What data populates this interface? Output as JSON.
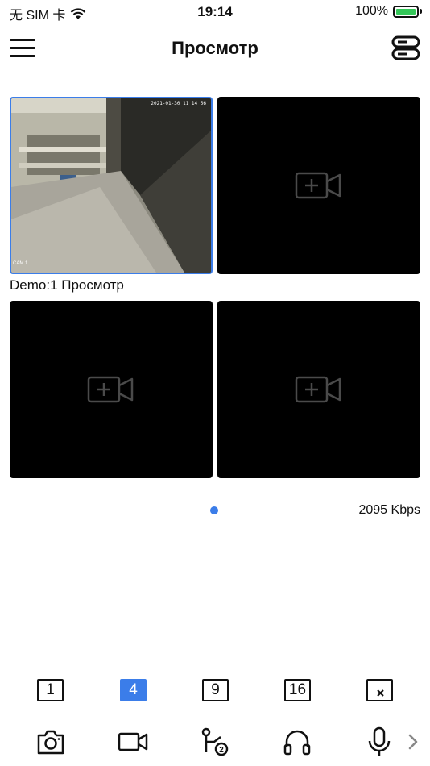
{
  "status": {
    "carrier": "无 SIM 卡",
    "time": "19:14",
    "battery": "100%"
  },
  "nav": {
    "title": "Просмотр"
  },
  "cells": [
    {
      "timestamp": "2021-01-30 11 14 56",
      "cam": "CAM 1"
    }
  ],
  "cell_label": "Demo:1 Просмотр",
  "bitrate": "2095 Kbps",
  "layouts": [
    {
      "label": "1"
    },
    {
      "label": "4"
    },
    {
      "label": "9"
    },
    {
      "label": "16"
    }
  ],
  "colors": {
    "accent": "#3b7de9",
    "battery": "#34c759"
  },
  "icons": [
    "menu-icon",
    "device-list-icon",
    "add-camera-icon",
    "snapshot-icon",
    "record-icon",
    "ptz-icon",
    "audio-icon",
    "microphone-icon",
    "chevron-right-icon",
    "close-all-icon"
  ]
}
